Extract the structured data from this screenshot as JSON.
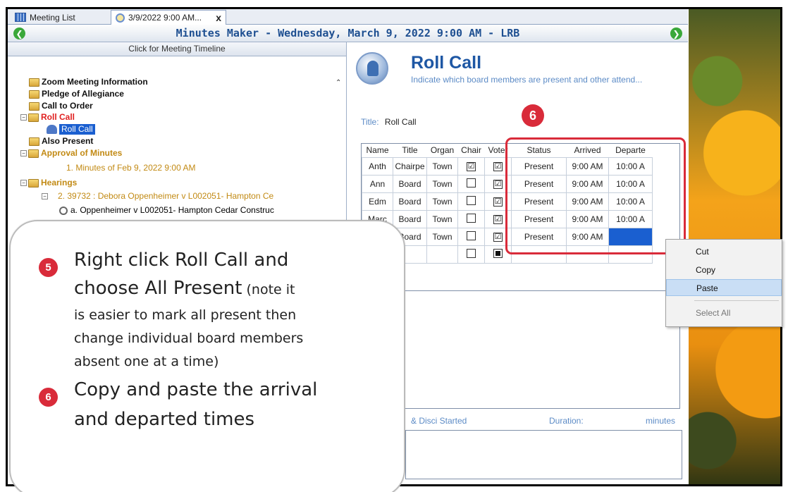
{
  "tabs": [
    {
      "label": "Meeting List",
      "icon": "calendar-grid-icon"
    },
    {
      "label": "3/9/2022 9:00 AM...",
      "icon": "clock-icon",
      "close": "x"
    }
  ],
  "titlebar": {
    "title": "Minutes Maker - Wednesday, March 9, 2022 9:00 AM - LRB",
    "back": "❮",
    "forward": "❯"
  },
  "tree": {
    "timeline": "Click for Meeting Timeline",
    "items": [
      {
        "label": "Zoom Meeting Information"
      },
      {
        "label": "Pledge of Allegiance"
      },
      {
        "label": "Call to Order"
      },
      {
        "label": "Roll Call"
      },
      {
        "label": "Roll Call"
      },
      {
        "label": "Also Present"
      },
      {
        "label": "Approval of Minutes"
      },
      {
        "label": "1. Minutes of Feb 9, 2022 9:00 AM"
      },
      {
        "label": "Hearings"
      },
      {
        "label": "2. 39732 : Debora Oppenheimer v L002051- Hampton Ce"
      },
      {
        "label": "a. Oppenheimer v L002051- Hampton Cedar Construc"
      }
    ]
  },
  "rollcall": {
    "heading": "Roll Call",
    "subtitle": "Indicate which board members are present and other attend...",
    "title_label": "Title:",
    "title_value": "Roll Call",
    "columns": [
      "Name",
      "Title",
      "Organ",
      "Chair",
      "Voter",
      "Status",
      "Arrived",
      "Departe"
    ],
    "rows": [
      {
        "name": "Anth",
        "title": "Chairpe",
        "org": "Town",
        "chair": "☑",
        "voter": "☑",
        "status": "Present",
        "arrived": "9:00 AM",
        "departed": "10:00 A"
      },
      {
        "name": "Ann",
        "title": "Board",
        "org": "Town",
        "chair": "",
        "voter": "☑",
        "status": "Present",
        "arrived": "9:00 AM",
        "departed": "10:00 A"
      },
      {
        "name": "Edm",
        "title": "Board",
        "org": "Town",
        "chair": "",
        "voter": "☑",
        "status": "Present",
        "arrived": "9:00 AM",
        "departed": "10:00 A"
      },
      {
        "name": "Marc",
        "title": "Board",
        "org": "Town",
        "chair": "",
        "voter": "☑",
        "status": "Present",
        "arrived": "9:00 AM",
        "departed": "10:00 A"
      },
      {
        "name": "",
        "title": "Board",
        "org": "Town",
        "chair": "",
        "voter": "☑",
        "status": "Present",
        "arrived": "9:00 AM",
        "departed": ""
      }
    ],
    "started_label": "& Disci Started",
    "duration_label": "Duration:",
    "minutes_label": "minutes"
  },
  "context_menu": {
    "items": [
      "Cut",
      "Copy",
      "Paste",
      "Select All"
    ],
    "highlighted": "Paste"
  },
  "badges": {
    "top": "6"
  },
  "callout": {
    "step5_number": "5",
    "step5_line1": "Right click Roll Call and",
    "step5_line2": "choose All Present",
    "step5_line2b": " (note it",
    "step5_line3": "is easier to mark all present then",
    "step5_line4": "change individual board members",
    "step5_line5": "absent one at a time)",
    "step6_number": "6",
    "step6_line1": "Copy and paste the arrival",
    "step6_line2": "and departed times"
  },
  "colors": {
    "accent": "#1e57a4",
    "highlight": "#d92b3a",
    "selection": "#1a5fd0"
  }
}
